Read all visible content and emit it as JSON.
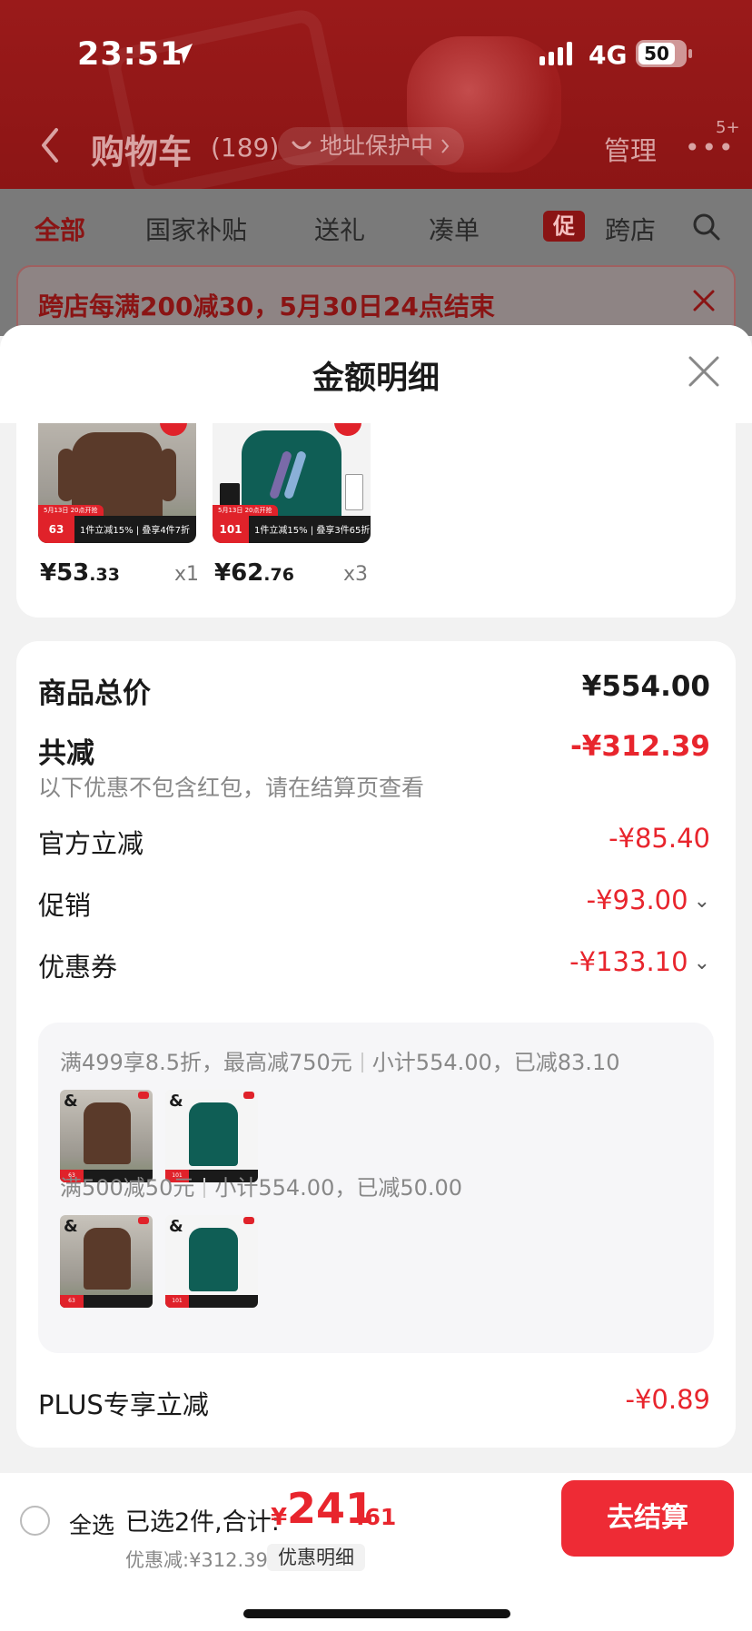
{
  "status_bar": {
    "time": "23:51",
    "network": "4G",
    "battery": "50"
  },
  "header": {
    "title": "购物车",
    "count": "(189)",
    "address_pill": "地址保护中",
    "manage": "管理",
    "more_badge": "5+"
  },
  "tabs": [
    "全部",
    "国家补贴",
    "送礼",
    "凑单",
    "跨店"
  ],
  "tab_promo_tag": "促",
  "banner": {
    "text": "跨店每满200减30，5月30日24点结束"
  },
  "sheet": {
    "title": "金额明细",
    "products": [
      {
        "price_int": "¥53",
        "price_dec": ".33",
        "qty": "x1",
        "badge_price": "63",
        "badge_text": "1件立减15% | 叠享4件7折"
      },
      {
        "price_int": "¥62",
        "price_dec": ".76",
        "qty": "x3",
        "badge_price": "101",
        "badge_text": "1件立减15% | 叠享3件65折"
      }
    ],
    "summary": {
      "total_label": "商品总价",
      "total_value": "¥554.00",
      "reduce_label": "共减",
      "reduce_value": "-¥312.39",
      "reduce_note": "以下优惠不包含红包，请在结算页查看",
      "official_label": "官方立减",
      "official_value": "-¥85.40",
      "promo_label": "促销",
      "promo_value": "-¥93.00",
      "coupon_label": "优惠券",
      "coupon_value": "-¥133.10",
      "plus_label": "PLUS专享立减",
      "plus_value": "-¥0.89"
    },
    "coupons": [
      {
        "rule": "满499享8.5折，最高减750元",
        "detail": "小计554.00，已减83.10",
        "thumb_prices": [
          "63",
          "101"
        ]
      },
      {
        "rule": "满500减50元",
        "detail": "小计554.00，已减50.00",
        "thumb_prices": [
          "63",
          "101"
        ]
      }
    ]
  },
  "bottom_bar": {
    "select_all": "全选",
    "selected_summary": "已选2件,合计:",
    "total_currency": "¥",
    "total_int": "241",
    "total_dec": ".61",
    "discount_text": "优惠减:¥312.39",
    "detail_tag": "优惠明细",
    "checkout": "去结算"
  },
  "colors": {
    "accent": "#ee2b35",
    "price_red": "#e8252d",
    "header_bg": "#9a1a1a"
  }
}
